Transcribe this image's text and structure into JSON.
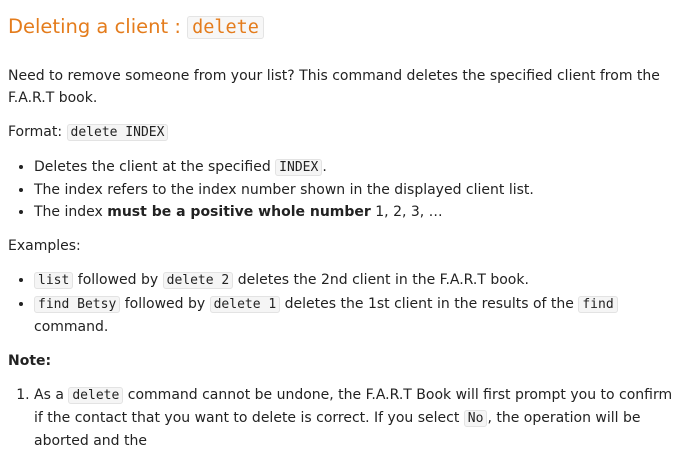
{
  "heading": {
    "title": "Deleting a client : ",
    "code": "delete"
  },
  "intro": "Need to remove someone from your list? This command deletes the specified client from the F.A.R.T book.",
  "format": {
    "label": "Format: ",
    "code": "delete INDEX"
  },
  "bullets": {
    "b1_pre": "Deletes the client at the specified ",
    "b1_code": "INDEX",
    "b1_post": ".",
    "b2": "The index refers to the index number shown in the displayed client list.",
    "b3_pre": "The index ",
    "b3_bold": "must be a positive whole number",
    "b3_post": " 1, 2, 3, …"
  },
  "examples": {
    "label": "Examples:",
    "e1_code1": "list",
    "e1_mid": " followed by ",
    "e1_code2": "delete 2",
    "e1_post": " deletes the 2nd client in the F.A.R.T book.",
    "e2_code1": "find Betsy",
    "e2_mid": " followed by ",
    "e2_code2": "delete 1",
    "e2_post": " deletes the 1st client in the results of the ",
    "e2_code3": "find",
    "e2_end": " command."
  },
  "note": {
    "label": "Note:",
    "n1_pre": "As a ",
    "n1_code1": "delete",
    "n1_mid": " command cannot be undone, the F.A.R.T Book will first prompt you to confirm if the contact that you want to delete is correct. If you select ",
    "n1_code2": "No",
    "n1_post": ", the operation will be aborted and the"
  }
}
